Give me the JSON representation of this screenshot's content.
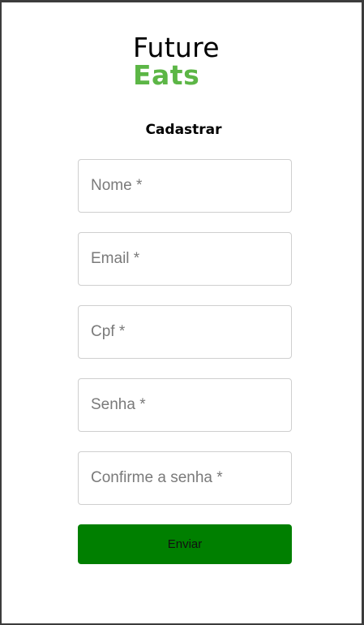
{
  "brand": {
    "line1": "Future",
    "line2": "Eats",
    "line1_color": "#000000",
    "line2_color": "#5cb646"
  },
  "form": {
    "title": "Cadastrar",
    "fields": [
      {
        "placeholder": "Nome *",
        "value": ""
      },
      {
        "placeholder": "Email *",
        "value": ""
      },
      {
        "placeholder": "Cpf *",
        "value": ""
      },
      {
        "placeholder": "Senha *",
        "value": ""
      },
      {
        "placeholder": "Confirme a senha *",
        "value": ""
      }
    ],
    "submit_label": "Enviar",
    "submit_color": "#007f00"
  }
}
